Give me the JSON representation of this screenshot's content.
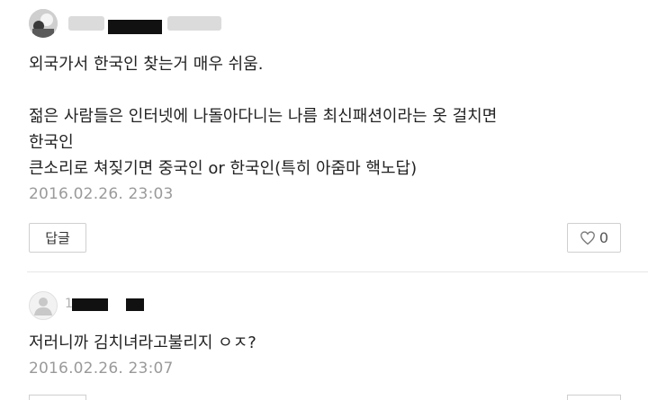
{
  "comments": [
    {
      "author": "",
      "lines": [
        "외국가서 한국인 찾는거 매우 쉬움.",
        "",
        "젊은 사람들은 인터넷에 나돌아다니는 나름 최신패션이라는 옷 걸치면",
        "한국인",
        "큰소리로 쳐짖기면 중국인 or 한국인(특히 아줌마 핵노답)"
      ],
      "time": "2016.02.26. 23:03",
      "reply_label": "답글",
      "like_count": "0"
    },
    {
      "author": "1",
      "lines": [
        "저러니까 김치녀라고불리지 ㅇㅈ?"
      ],
      "time": "2016.02.26. 23:07"
    }
  ],
  "icons": {
    "like": "heart-outline-icon",
    "avatar_default": "person-icon"
  },
  "colors": {
    "timestamp": "#9a9a9a",
    "border": "#cfcfcf"
  }
}
